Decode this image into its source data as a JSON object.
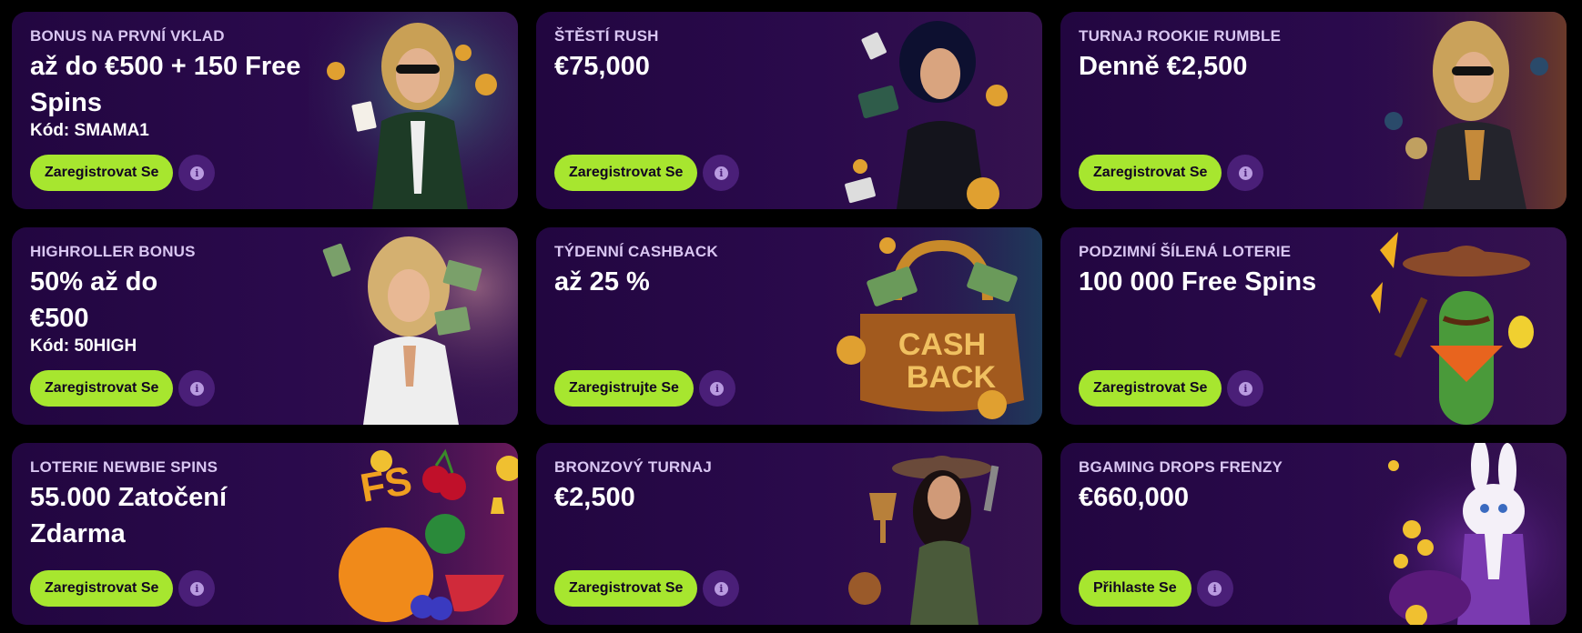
{
  "cards": [
    {
      "eyebrow": "BONUS NA PRVNÍ VKLAD",
      "headline": "až do €500 + 150 Free Spins",
      "code": "Kód: SMAMA1",
      "cta": "Zaregistrovat Se"
    },
    {
      "eyebrow": "ŠTĚSTÍ RUSH",
      "headline": "€75,000",
      "code": "",
      "cta": "Zaregistrovat Se"
    },
    {
      "eyebrow": "TURNAJ ROOKIE RUMBLE",
      "headline": "Denně €2,500",
      "code": "",
      "cta": "Zaregistrovat Se"
    },
    {
      "eyebrow": "HIGHROLLER BONUS",
      "headline": "50% až do €500",
      "code": "Kód: 50HIGH",
      "cta": "Zaregistrovat Se"
    },
    {
      "eyebrow": "TÝDENNÍ CASHBACK",
      "headline": "až 25 %",
      "code": "",
      "cta": "Zaregistrujte Se",
      "art_text": [
        "CASH",
        "BACK"
      ]
    },
    {
      "eyebrow": "PODZIMNÍ ŠÍLENÁ LOTERIE",
      "headline": "100 000 Free Spins",
      "code": "",
      "cta": "Zaregistrovat Se"
    },
    {
      "eyebrow": "LOTERIE NEWBIE SPINS",
      "headline": "55.000 Zatočení Zdarma",
      "code": "",
      "cta": "Zaregistrovat Se",
      "art_text": [
        "FS"
      ]
    },
    {
      "eyebrow": "BRONZOVÝ TURNAJ",
      "headline": "€2,500",
      "code": "",
      "cta": "Zaregistrovat Se"
    },
    {
      "eyebrow": "BGAMING DROPS FRENZY",
      "headline": "€660,000",
      "code": "",
      "cta": "Přihlaste Se"
    }
  ],
  "info_icon_glyph": "i",
  "colors": {
    "cta": "#a7e62f",
    "card_bg": "#220640",
    "info_bg": "#4a1f78"
  }
}
